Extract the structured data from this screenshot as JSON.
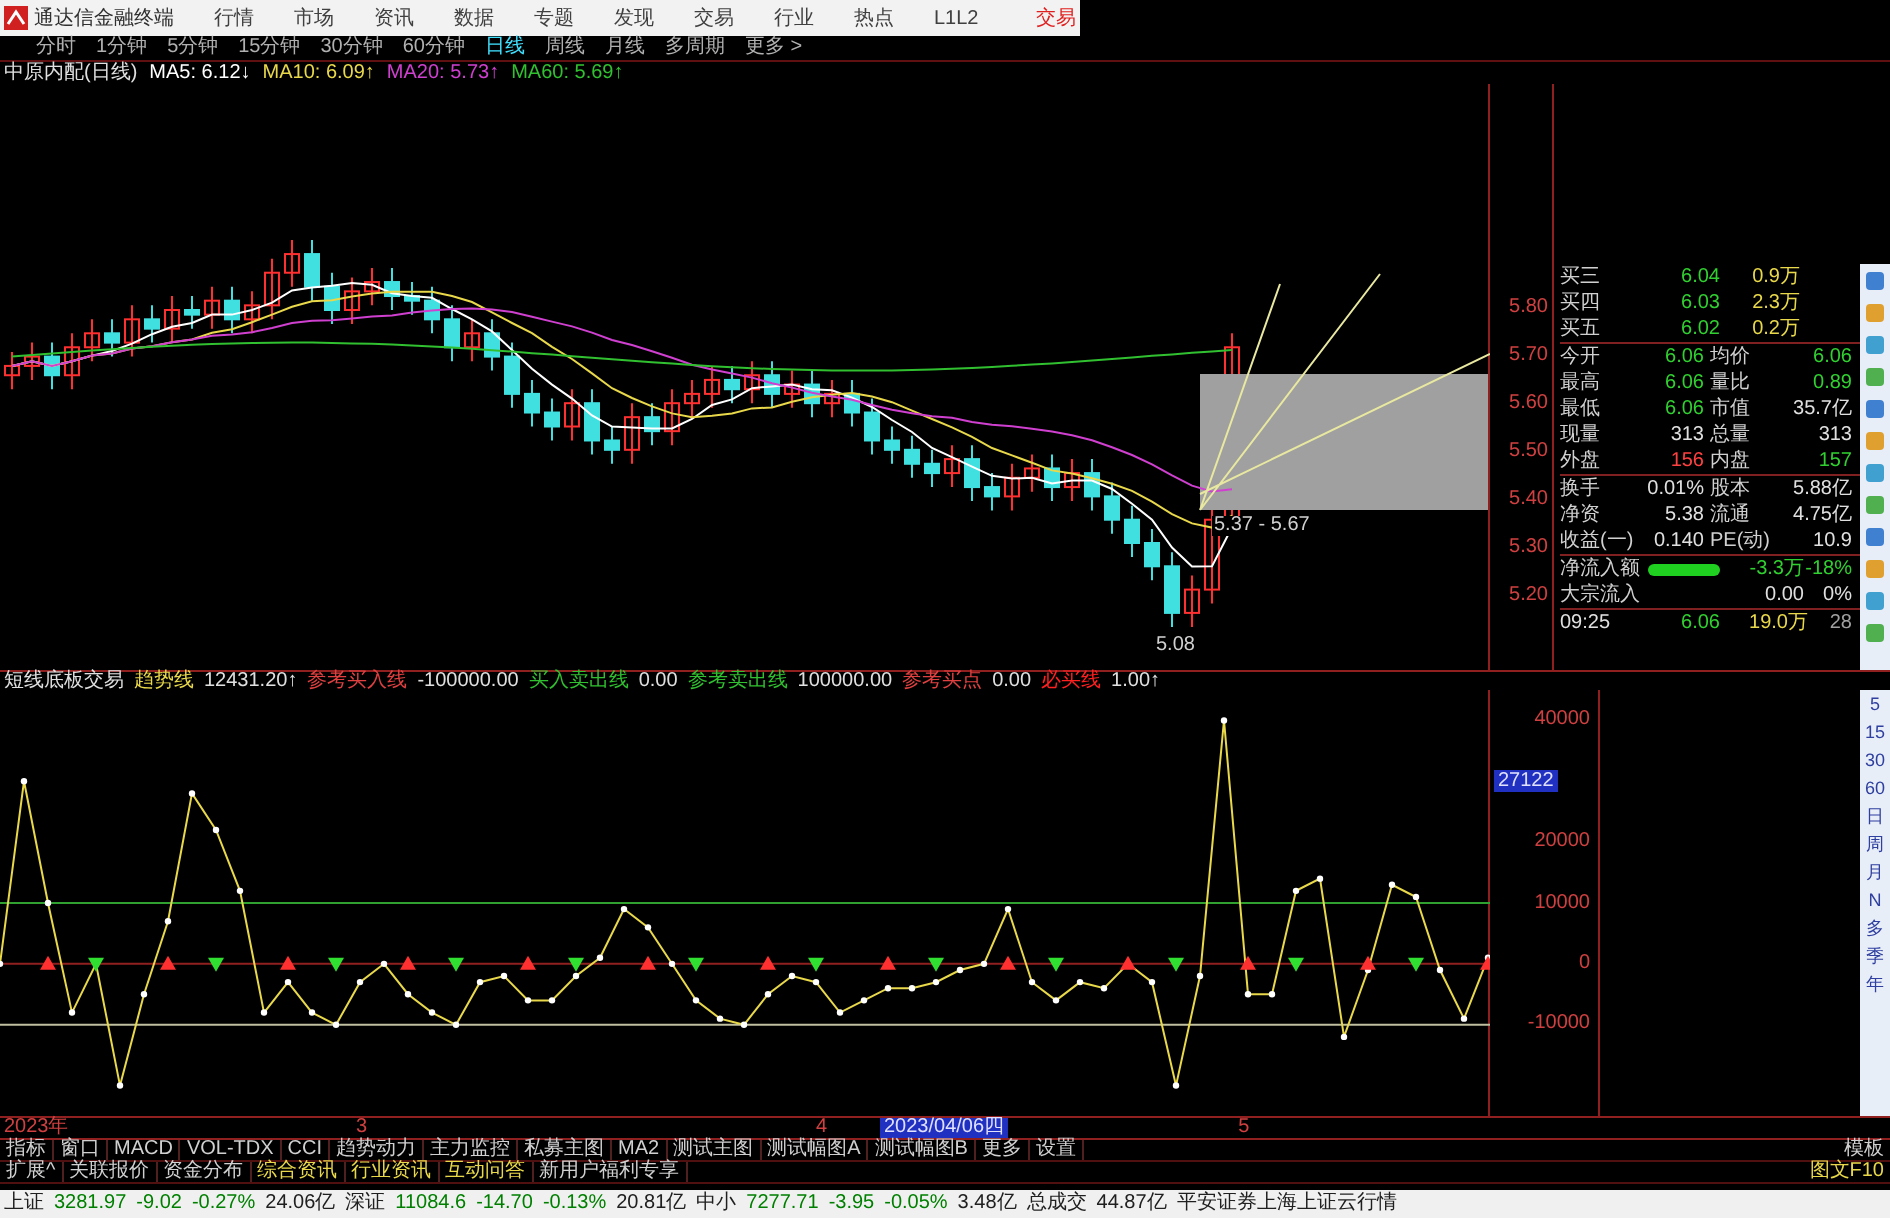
{
  "menu_bar": {
    "title": "通达信金融终端",
    "items": [
      "行情",
      "市场",
      "资讯",
      "数据",
      "专题",
      "发现",
      "交易",
      "行业",
      "热点",
      "L1L2"
    ],
    "trade": "交易"
  },
  "period_bar": {
    "items": [
      {
        "label": "分时",
        "selected": false
      },
      {
        "label": "1分钟",
        "selected": false
      },
      {
        "label": "5分钟",
        "selected": false
      },
      {
        "label": "15分钟",
        "selected": false
      },
      {
        "label": "30分钟",
        "selected": false
      },
      {
        "label": "60分钟",
        "selected": false
      },
      {
        "label": "日线",
        "selected": true
      },
      {
        "label": "周线",
        "selected": false
      },
      {
        "label": "月线",
        "selected": false
      },
      {
        "label": "多周期",
        "selected": false
      },
      {
        "label": "更多 >",
        "selected": false
      }
    ]
  },
  "ma_legend": {
    "stock": "中原内配(日线)",
    "items": [
      {
        "text": "MA5: 6.12↓",
        "color": "#ffffff"
      },
      {
        "text": "MA10: 6.09↑",
        "color": "#e8d84a"
      },
      {
        "text": "MA20: 5.73↑",
        "color": "#d040d0"
      },
      {
        "text": "MA60: 5.69↑",
        "color": "#30c030"
      }
    ]
  },
  "price_chart": {
    "range_label": "5.37 - 5.67",
    "low_label": "5.08",
    "axis": [
      "5.80",
      "5.70",
      "5.60",
      "5.50",
      "5.40",
      "5.30",
      "5.20"
    ]
  },
  "quote": {
    "rows": [
      {
        "kind": "order",
        "label": "买三",
        "price": "6.04",
        "volume": "0.9万"
      },
      {
        "kind": "order",
        "label": "买四",
        "price": "6.03",
        "volume": "2.3万"
      },
      {
        "kind": "order",
        "label": "买五",
        "price": "6.02",
        "volume": "0.2万"
      },
      {
        "kind": "pair",
        "left": {
          "label": "今开",
          "value": "6.06",
          "color": "#30d030"
        },
        "right": {
          "label": "均价",
          "value": "6.06",
          "color": "#30d030"
        }
      },
      {
        "kind": "pair",
        "left": {
          "label": "最高",
          "value": "6.06",
          "color": "#30d030"
        },
        "right": {
          "label": "量比",
          "value": "0.89",
          "color": "#30d030"
        }
      },
      {
        "kind": "pair",
        "left": {
          "label": "最低",
          "value": "6.06",
          "color": "#30d030"
        },
        "right": {
          "label": "市值",
          "value": "35.7亿",
          "color": "#e0e0e0"
        }
      },
      {
        "kind": "pair",
        "left": {
          "label": "现量",
          "value": "313",
          "color": "#e0e0e0"
        },
        "right": {
          "label": "总量",
          "value": "313",
          "color": "#e0e0e0"
        }
      },
      {
        "kind": "pair",
        "left": {
          "label": "外盘",
          "value": "156",
          "color": "#ff4040"
        },
        "right": {
          "label": "内盘",
          "value": "157",
          "color": "#30d030"
        }
      },
      {
        "kind": "pair",
        "left": {
          "label": "换手",
          "value": "0.01%",
          "color": "#e0e0e0"
        },
        "right": {
          "label": "股本",
          "value": "5.88亿",
          "color": "#e0e0e0"
        }
      },
      {
        "kind": "pair",
        "left": {
          "label": "净资",
          "value": "5.38",
          "color": "#e0e0e0"
        },
        "right": {
          "label": "流通",
          "value": "4.75亿",
          "color": "#e0e0e0"
        }
      },
      {
        "kind": "pair",
        "left": {
          "label": "收益(一)",
          "value": "0.140",
          "color": "#e0e0e0"
        },
        "right": {
          "label": "PE(动)",
          "value": "10.9",
          "color": "#e0e0e0"
        }
      },
      {
        "kind": "flow_bar",
        "label": "净流入额",
        "value": "-3.3万",
        "pct": "-18%"
      },
      {
        "kind": "flow",
        "label": "大宗流入",
        "value": "0.00",
        "pct": "0%"
      },
      {
        "kind": "tick",
        "time": "09:25",
        "price": "6.06",
        "volume": "19.0万",
        "count": "28"
      }
    ]
  },
  "indicator": {
    "name": "短线底板交易",
    "trend_value": "12431.20↑",
    "items": [
      {
        "label": "参考买入线",
        "value": "-100000.00",
        "color": "#e04040"
      },
      {
        "label": "买入卖出线",
        "value": "0.00",
        "color": "#30c030"
      },
      {
        "label": "参考卖出线",
        "value": "100000.00",
        "color": "#30c030"
      },
      {
        "label": "参考买点",
        "value": "0.00",
        "color": "#e04040"
      },
      {
        "label": "必买线",
        "value": "1.00↑",
        "color": "#ff2020"
      }
    ],
    "chart_data": {
      "type": "line",
      "ylim": [
        -25000,
        45000
      ],
      "yticks": [
        40000,
        20000,
        10000,
        0,
        -10000
      ],
      "ref_lines": [
        {
          "axis": "y",
          "value": 10000,
          "color": "#30a030"
        },
        {
          "axis": "y",
          "value": 0,
          "color": "#902020"
        },
        {
          "axis": "y",
          "value": -10000,
          "color": "#c0c0a0"
        }
      ],
      "series": [
        {
          "name": "趋势线",
          "color": "#e8d84a",
          "marker": "circle",
          "values": [
            0,
            30000,
            10000,
            -8000,
            0,
            -20000,
            -5000,
            7000,
            28000,
            22000,
            12000,
            -8000,
            -3000,
            -8000,
            -10000,
            -3000,
            0,
            -5000,
            -8000,
            -10000,
            -3000,
            -2000,
            -6000,
            -6000,
            -2000,
            1000,
            9000,
            6000,
            0,
            -6000,
            -9000,
            -10000,
            -5000,
            -2000,
            -3000,
            -8000,
            -6000,
            -4000,
            -4000,
            -3000,
            -1000,
            0,
            9000,
            -3000,
            -6000,
            -3000,
            -4000,
            0,
            -3000,
            -20000,
            -2000,
            40000,
            -5000,
            -5000,
            12000,
            14000,
            -12000,
            -1000,
            13000,
            11000,
            -1000,
            -9000,
            1000
          ]
        }
      ]
    },
    "cursor_value": "27122"
  },
  "date_bar": {
    "year": "2023年",
    "marks": [
      "3",
      "4",
      "5"
    ],
    "cursor_date": "2023/04/06四"
  },
  "tab_rows": [
    {
      "tabs": [
        "指标",
        "窗口",
        "MACD",
        "VOL-TDX",
        "CCI",
        "趋势动力",
        "主力监控",
        "私募主图",
        "MA2",
        "测试主图",
        "测试幅图A",
        "测试幅图B",
        "更多",
        "设置"
      ],
      "right": "模板"
    },
    {
      "tabs": [
        "扩展^",
        "关联报价",
        "资金分布",
        "综合资讯",
        "行业资讯",
        "互动问答",
        "新用户福利专享"
      ],
      "right": "图文F10"
    }
  ],
  "right_toolbar": {
    "periods": [
      "5",
      "15",
      "30",
      "60",
      "日",
      "周",
      "月",
      "N",
      "多",
      "季",
      "年"
    ]
  },
  "status_bar": {
    "indices": [
      {
        "name": "上证",
        "value": "3281.97",
        "change": "-9.02",
        "pct": "-0.27%",
        "amount": "24.06亿"
      },
      {
        "name": "深证",
        "value": "11084.6",
        "change": "-14.70",
        "pct": "-0.13%",
        "amount": "20.81亿"
      },
      {
        "name": "中小",
        "value": "7277.71",
        "change": "-3.95",
        "pct": "-0.05%",
        "amount": "3.48亿"
      }
    ],
    "total_label": "总成交",
    "total": "44.87亿",
    "source": "平安证券上海上证云行情"
  }
}
